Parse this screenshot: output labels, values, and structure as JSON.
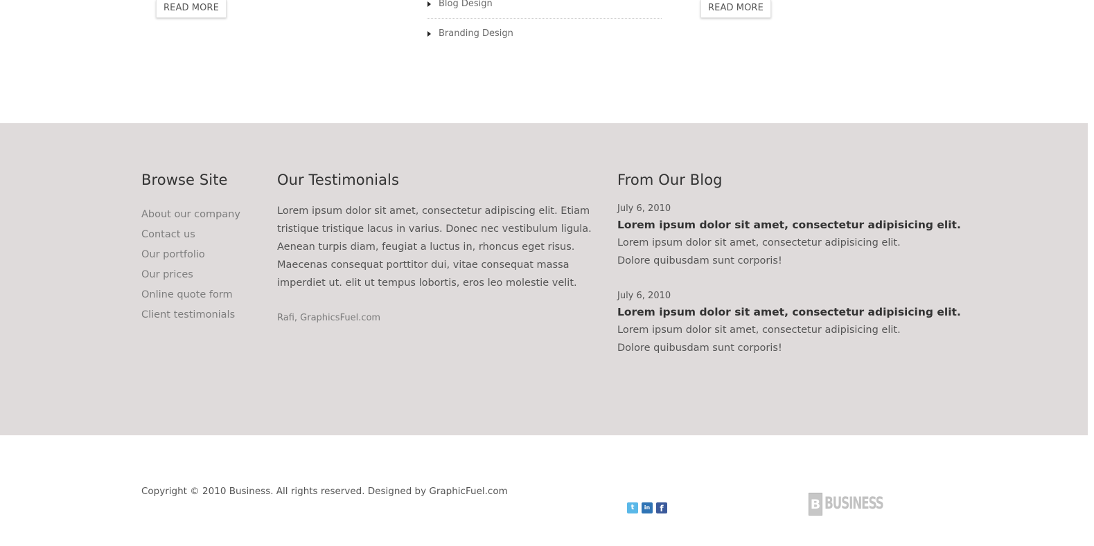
{
  "top": {
    "read_more_left": "READ MORE",
    "read_more_right": "READ MORE",
    "services": [
      "Blog Design",
      "Branding Design"
    ]
  },
  "footer": {
    "browse": {
      "title": "Browse Site",
      "links": [
        "About our company",
        "Contact us",
        "Our portfolio",
        "Our prices",
        "Online quote form",
        "Client testimonials"
      ]
    },
    "testimonials": {
      "title": "Our Testimonials",
      "text": "Lorem ipsum dolor sit amet, consectetur adipiscing elit. Etiam tristique tristique lacus in varius. Donec nec vestibulum ligula. Aenean turpis diam, feugiat a luctus in, rhoncus eget risus. Maecenas consequat porttitor dui, vitae consequat massa imperdiet ut. elit ut tempus lobortis, eros leo molestie velit.",
      "author": "Rafi, GraphicsFuel.com"
    },
    "blog": {
      "title": "From Our Blog",
      "posts": [
        {
          "date": "July 6, 2010",
          "title": "Lorem ipsum dolor sit amet, consectetur adipisicing elit.",
          "excerpt": "Lorem ipsum dolor sit amet, consectetur adipisicing elit. Dolore quibusdam sunt corporis!"
        },
        {
          "date": "July 6, 2010",
          "title": "Lorem ipsum dolor sit amet, consectetur adipisicing elit.",
          "excerpt": "Lorem ipsum dolor sit amet, consectetur adipisicing elit. Dolore quibusdam sunt corporis!"
        }
      ]
    }
  },
  "bottom": {
    "copyright": "Copyright © 2010 Business. All rights reserved. Designed by GraphicFuel.com",
    "social": [
      {
        "icon": "twitter-icon",
        "glyph": "t",
        "color": "#5ab8e8"
      },
      {
        "icon": "linkedin-icon",
        "glyph": "in",
        "color": "#2f74b5"
      },
      {
        "icon": "facebook-icon",
        "glyph": "f",
        "color": "#3b5a9b"
      }
    ],
    "logo": {
      "mark": "B",
      "text": "BUSINESS"
    }
  },
  "colors": {
    "footer_background": "#dfdbdb",
    "heading_text": "#333333",
    "body_text": "#555555",
    "link_text": "#7d7d7d"
  }
}
